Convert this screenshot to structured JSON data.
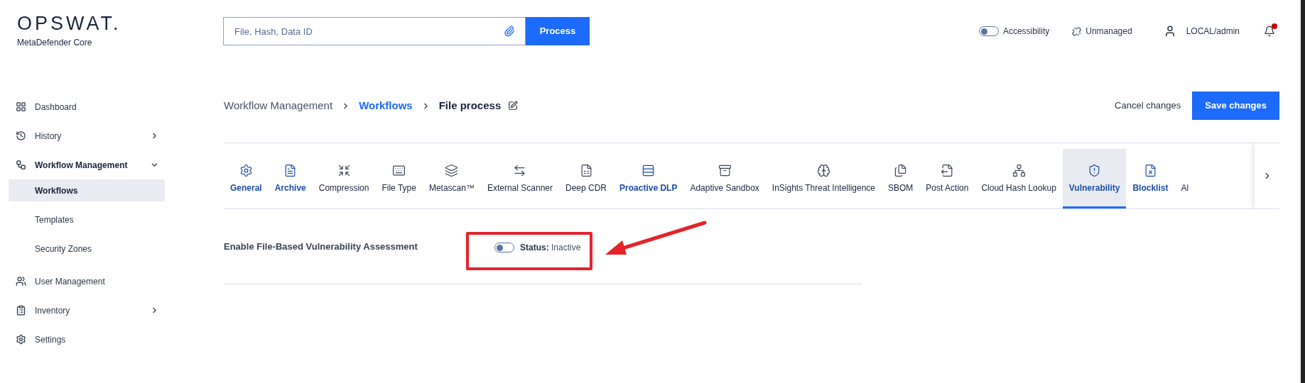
{
  "logo": {
    "wordmark": "OPSWAT.",
    "product": "MetaDefender Core"
  },
  "search": {
    "placeholder": "File, Hash, Data ID",
    "button": "Process"
  },
  "header": {
    "accessibility": {
      "label": "Accessibility",
      "on": false
    },
    "management": "Unmanaged",
    "user": "LOCAL/admin",
    "notifications_unread": true
  },
  "sidebar": {
    "items": [
      {
        "label": "Dashboard"
      },
      {
        "label": "History",
        "expanded": false
      },
      {
        "label": "Workflow Management",
        "expanded": true,
        "children": [
          {
            "label": "Workflows",
            "selected": true
          },
          {
            "label": "Templates",
            "selected": false
          },
          {
            "label": "Security Zones",
            "selected": false
          }
        ]
      },
      {
        "label": "User Management"
      },
      {
        "label": "Inventory",
        "expanded": false
      },
      {
        "label": "Settings"
      }
    ]
  },
  "breadcrumb": [
    {
      "label": "Workflow Management",
      "kind": "plain"
    },
    {
      "label": "Workflows",
      "kind": "link"
    },
    {
      "label": "File process",
      "kind": "current"
    }
  ],
  "actions": {
    "cancel": "Cancel changes",
    "save": "Save changes"
  },
  "tabs": [
    {
      "label": "General",
      "enabled": true,
      "selected": false
    },
    {
      "label": "Archive",
      "enabled": true,
      "selected": false
    },
    {
      "label": "Compression",
      "enabled": false,
      "selected": false
    },
    {
      "label": "File Type",
      "enabled": false,
      "selected": false
    },
    {
      "label": "Metascan™",
      "enabled": false,
      "selected": false
    },
    {
      "label": "External Scanner",
      "enabled": false,
      "selected": false
    },
    {
      "label": "Deep CDR",
      "enabled": false,
      "selected": false
    },
    {
      "label": "Proactive DLP",
      "enabled": true,
      "selected": false
    },
    {
      "label": "Adaptive Sandbox",
      "enabled": false,
      "selected": false
    },
    {
      "label": "InSights Threat Intelligence",
      "enabled": false,
      "selected": false
    },
    {
      "label": "SBOM",
      "enabled": false,
      "selected": false
    },
    {
      "label": "Post Action",
      "enabled": false,
      "selected": false
    },
    {
      "label": "Cloud Hash Lookup",
      "enabled": false,
      "selected": false
    },
    {
      "label": "Vulnerability",
      "enabled": true,
      "selected": true
    },
    {
      "label": "Blocklist",
      "enabled": true,
      "selected": false
    },
    {
      "label": "Al",
      "enabled": false,
      "selected": false
    }
  ],
  "setting": {
    "label": "Enable File-Based Vulnerability Assessment",
    "on": false,
    "status_label": "Status:",
    "status_value": "Inactive"
  }
}
